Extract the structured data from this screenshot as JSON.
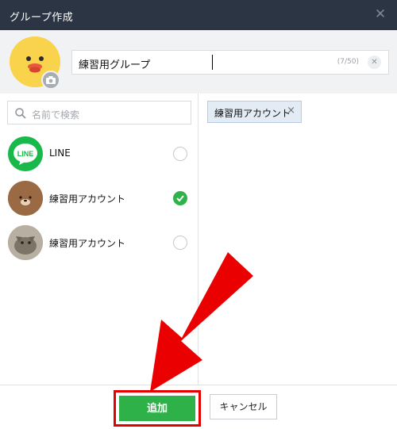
{
  "window": {
    "title": "グループ作成",
    "close_icon": "close-icon"
  },
  "group": {
    "name_value": "練習用グループ",
    "char_count": "(7/50)"
  },
  "search": {
    "placeholder": "名前で検索"
  },
  "friends": [
    {
      "name": "LINE",
      "selected": false,
      "avatar": "line-logo"
    },
    {
      "name": "練習用アカウント",
      "selected": true,
      "avatar": "brown-bear"
    },
    {
      "name": "練習用アカウント",
      "selected": false,
      "avatar": "cat-photo"
    }
  ],
  "selected_chips": [
    {
      "label": "練習用アカウント",
      "remove": "×"
    }
  ],
  "footer": {
    "add_label": "追加",
    "cancel_label": "キャンセル"
  },
  "colors": {
    "titlebar": "#2b3543",
    "accent_green": "#2fb14a",
    "highlight_red": "#e50000",
    "chip_bg": "#e3ebf4"
  }
}
